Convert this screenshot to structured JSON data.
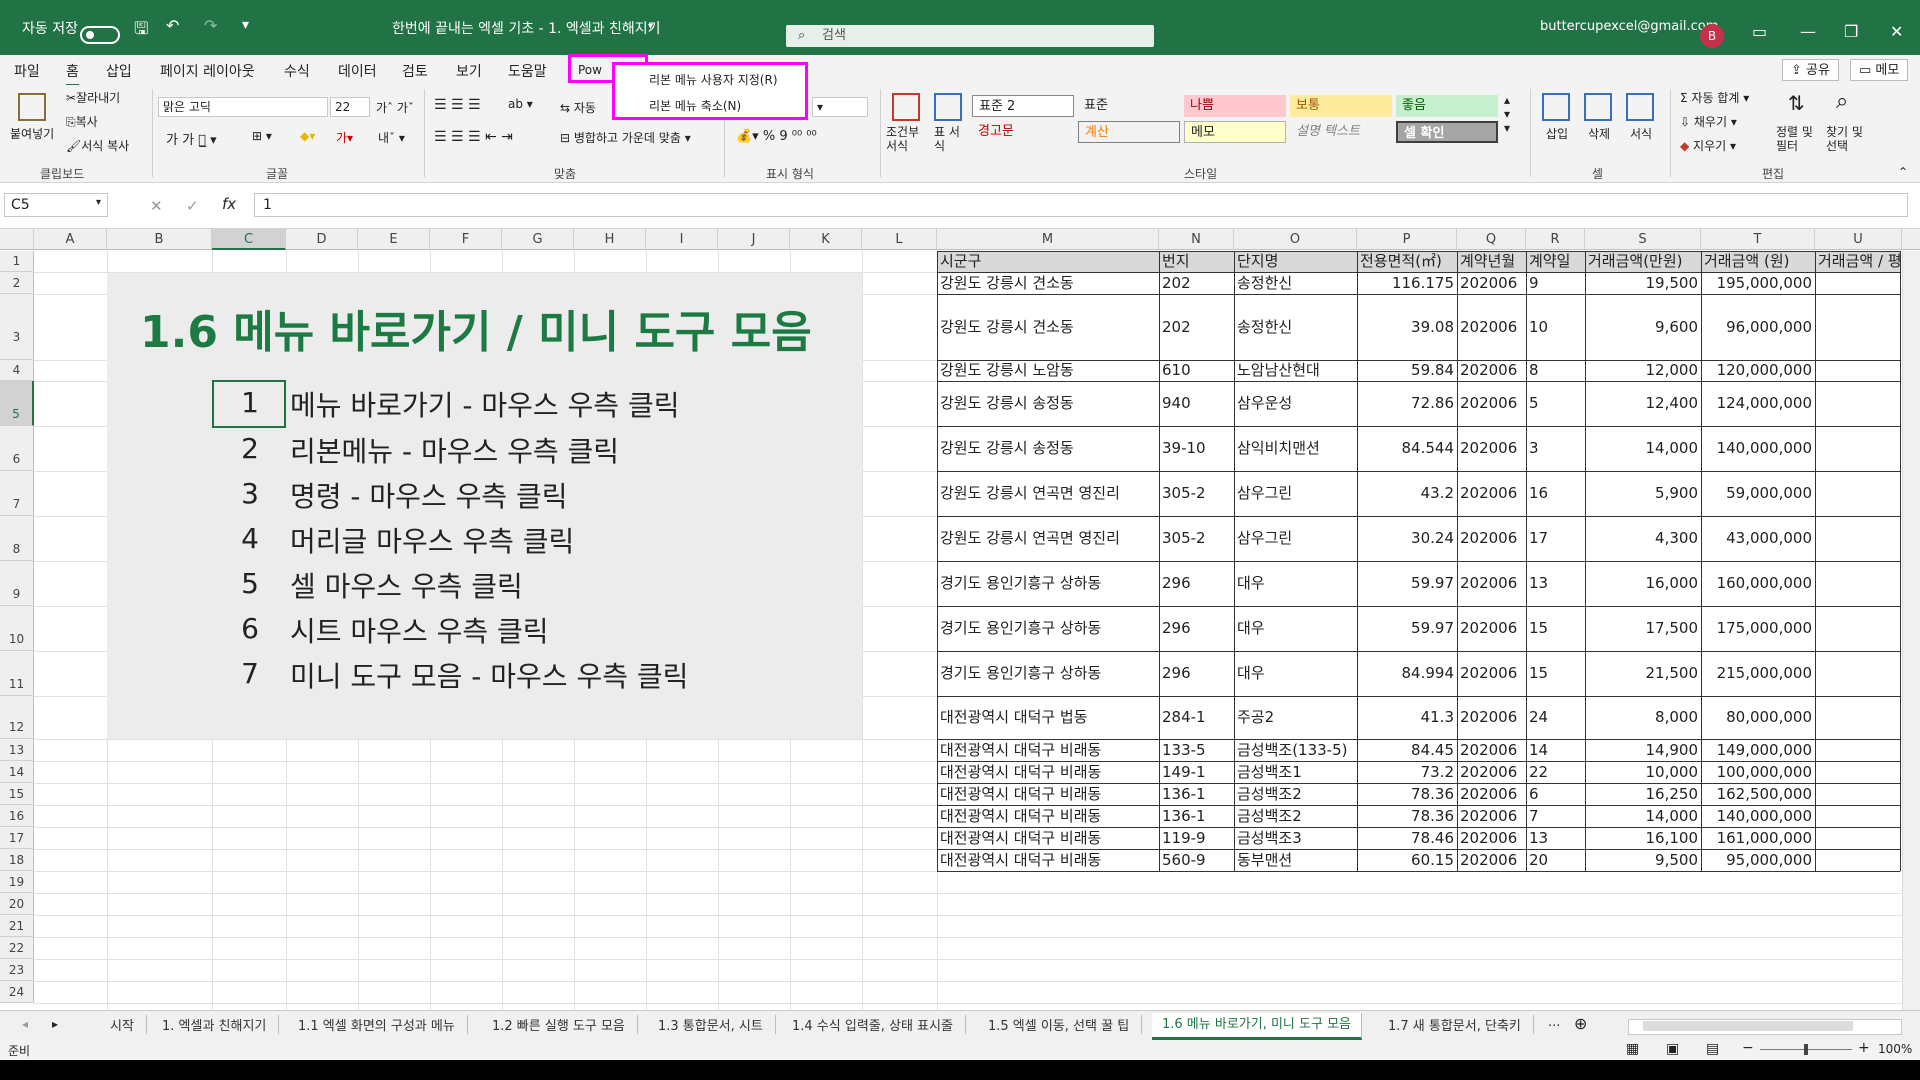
{
  "titlebar": {
    "autosave_label": "자동 저장",
    "autosave_state": "끔",
    "doc_title": "한번에 끝내는 엑셀 기초 - 1. 엑셀과 친해지기",
    "search_placeholder": "검색",
    "account": "buttercupexcel@gmail.com",
    "avatar_letter": "B"
  },
  "ribbon_tabs": [
    "파일",
    "홈",
    "삽입",
    "페이지 레이아웃",
    "수식",
    "데이터",
    "검토",
    "보기",
    "도움말",
    "Pow"
  ],
  "active_tab": "홈",
  "share_label": "공유",
  "memo_label": "메모",
  "context_menu": {
    "items": [
      "리본 메뉴 사용자 지정(R)",
      "리본 메뉴 축소(N)"
    ]
  },
  "ribbon": {
    "clipboard": {
      "paste": "붙여넣기",
      "cut": "잘라내기",
      "copy": "복사",
      "format_painter": "서식 복사",
      "group": "클립보드"
    },
    "font": {
      "font_name": "맑은 고딕",
      "font_size": "22",
      "group": "글꼴"
    },
    "align": {
      "wrap": "자동",
      "merge": "병합하고 가운데 맞춤",
      "group": "맞춤"
    },
    "number": {
      "group": "표시 형식"
    },
    "styles": {
      "cond_format": "조건부 서식",
      "table_format": "표 서식",
      "cells": [
        "표준 2",
        "표준",
        "나쁨",
        "보통",
        "좋음",
        "경고문",
        "계산",
        "메모",
        "설명 텍스트",
        "셀 확인"
      ],
      "group": "스타일"
    },
    "cells_group": {
      "insert": "삽입",
      "delete": "삭제",
      "format": "서식",
      "group": "셀"
    },
    "editing": {
      "autosum": "자동 합계",
      "fill": "채우기",
      "clear": "지우기",
      "sort": "정렬 및 필터",
      "find": "찾기 및 선택",
      "group": "편집"
    }
  },
  "formula_bar": {
    "name_box": "C5",
    "value": "1"
  },
  "columns_left": [
    "A",
    "B",
    "C",
    "D",
    "E",
    "F",
    "G",
    "H",
    "I",
    "J",
    "K",
    "L"
  ],
  "columns_right": [
    "M",
    "N",
    "O",
    "P",
    "Q",
    "R",
    "S",
    "T",
    "U"
  ],
  "rows": [
    "1",
    "2",
    "3",
    "4",
    "5",
    "6",
    "7",
    "8",
    "9",
    "10",
    "11",
    "12",
    "13",
    "14",
    "15",
    "16",
    "17",
    "18",
    "19",
    "20",
    "21",
    "22",
    "23",
    "24"
  ],
  "panel": {
    "title": "1.6 메뉴 바로가기 / 미니 도구 모음",
    "items": [
      {
        "n": "1",
        "t": "메뉴 바로가기  - 마우스 우측 클릭"
      },
      {
        "n": "2",
        "t": "리본메뉴 - 마우스 우측 클릭"
      },
      {
        "n": "3",
        "t": "명령 - 마우스 우측 클릭"
      },
      {
        "n": "4",
        "t": "머리글 마우스 우측 클릭"
      },
      {
        "n": "5",
        "t": "셀 마우스 우측 클릭"
      },
      {
        "n": "6",
        "t": "시트 마우스 우측 클릭"
      },
      {
        "n": "7",
        "t": "미니 도구 모음 - 마우스 우측 클릭"
      }
    ]
  },
  "table": {
    "headers": [
      "시군구",
      "번지",
      "단지명",
      "전용면적(㎡)",
      "계약년월",
      "계약일",
      "거래금액(만원)",
      "거래금액 (원)",
      "거래금액 / 평"
    ],
    "rows": [
      [
        "강원도 강릉시 견소동",
        "202",
        "송정한신",
        "116.175",
        "202006",
        "9",
        "19,500",
        "195,000,000"
      ],
      [
        "강원도 강릉시 견소동",
        "202",
        "송정한신",
        "39.08",
        "202006",
        "10",
        "9,600",
        "96,000,000"
      ],
      [
        "강원도 강릉시 노암동",
        "610",
        "노암남산현대",
        "59.84",
        "202006",
        "8",
        "12,000",
        "120,000,000"
      ],
      [
        "강원도 강릉시 송정동",
        "940",
        "삼우운성",
        "72.86",
        "202006",
        "5",
        "12,400",
        "124,000,000"
      ],
      [
        "강원도 강릉시 송정동",
        "39-10",
        "삼익비치맨션",
        "84.544",
        "202006",
        "3",
        "14,000",
        "140,000,000"
      ],
      [
        "강원도 강릉시 연곡면 영진리",
        "305-2",
        "삼우그린",
        "43.2",
        "202006",
        "16",
        "5,900",
        "59,000,000"
      ],
      [
        "강원도 강릉시 연곡면 영진리",
        "305-2",
        "삼우그린",
        "30.24",
        "202006",
        "17",
        "4,300",
        "43,000,000"
      ],
      [
        "경기도 용인기흥구 상하동",
        "296",
        "대우",
        "59.97",
        "202006",
        "13",
        "16,000",
        "160,000,000"
      ],
      [
        "경기도 용인기흥구 상하동",
        "296",
        "대우",
        "59.97",
        "202006",
        "15",
        "17,500",
        "175,000,000"
      ],
      [
        "경기도 용인기흥구 상하동",
        "296",
        "대우",
        "84.994",
        "202006",
        "15",
        "21,500",
        "215,000,000"
      ],
      [
        "대전광역시 대덕구 법동",
        "284-1",
        "주공2",
        "41.3",
        "202006",
        "24",
        "8,000",
        "80,000,000"
      ],
      [
        "대전광역시 대덕구 비래동",
        "133-5",
        "금성백조(133-5)",
        "84.45",
        "202006",
        "14",
        "14,900",
        "149,000,000"
      ],
      [
        "대전광역시 대덕구 비래동",
        "149-1",
        "금성백조1",
        "73.2",
        "202006",
        "22",
        "10,000",
        "100,000,000"
      ],
      [
        "대전광역시 대덕구 비래동",
        "136-1",
        "금성백조2",
        "78.36",
        "202006",
        "6",
        "16,250",
        "162,500,000"
      ],
      [
        "대전광역시 대덕구 비래동",
        "136-1",
        "금성백조2",
        "78.36",
        "202006",
        "7",
        "14,000",
        "140,000,000"
      ],
      [
        "대전광역시 대덕구 비래동",
        "119-9",
        "금성백조3",
        "78.46",
        "202006",
        "13",
        "16,100",
        "161,000,000"
      ],
      [
        "대전광역시 대덕구 비래동",
        "560-9",
        "동부맨션",
        "60.15",
        "202006",
        "20",
        "9,500",
        "95,000,000"
      ]
    ]
  },
  "sheet_tabs": [
    "시작",
    "1. 엑셀과 친해지기",
    "1.1 엑셀 화면의 구성과 메뉴",
    "1.2 빠른 실행 도구 모음",
    "1.3 통합문서, 시트",
    "1.4 수식 입력줄, 상태 표시줄",
    "1.5 엑셀 이동, 선택 꿀 팁",
    "1.6 메뉴 바로가기, 미니 도구 모음",
    "1.7 새 통합문서, 단축키",
    "..."
  ],
  "active_sheet": "1.6 메뉴 바로가기, 미니 도구 모음",
  "status": {
    "ready": "준비",
    "zoom": "100%"
  },
  "colors": {
    "excel_green": "#217346",
    "highlight": "#ff00ff",
    "bad_fill": "#ffc7ce",
    "neutral_fill": "#ffeb9c",
    "good_fill": "#c6efce"
  }
}
